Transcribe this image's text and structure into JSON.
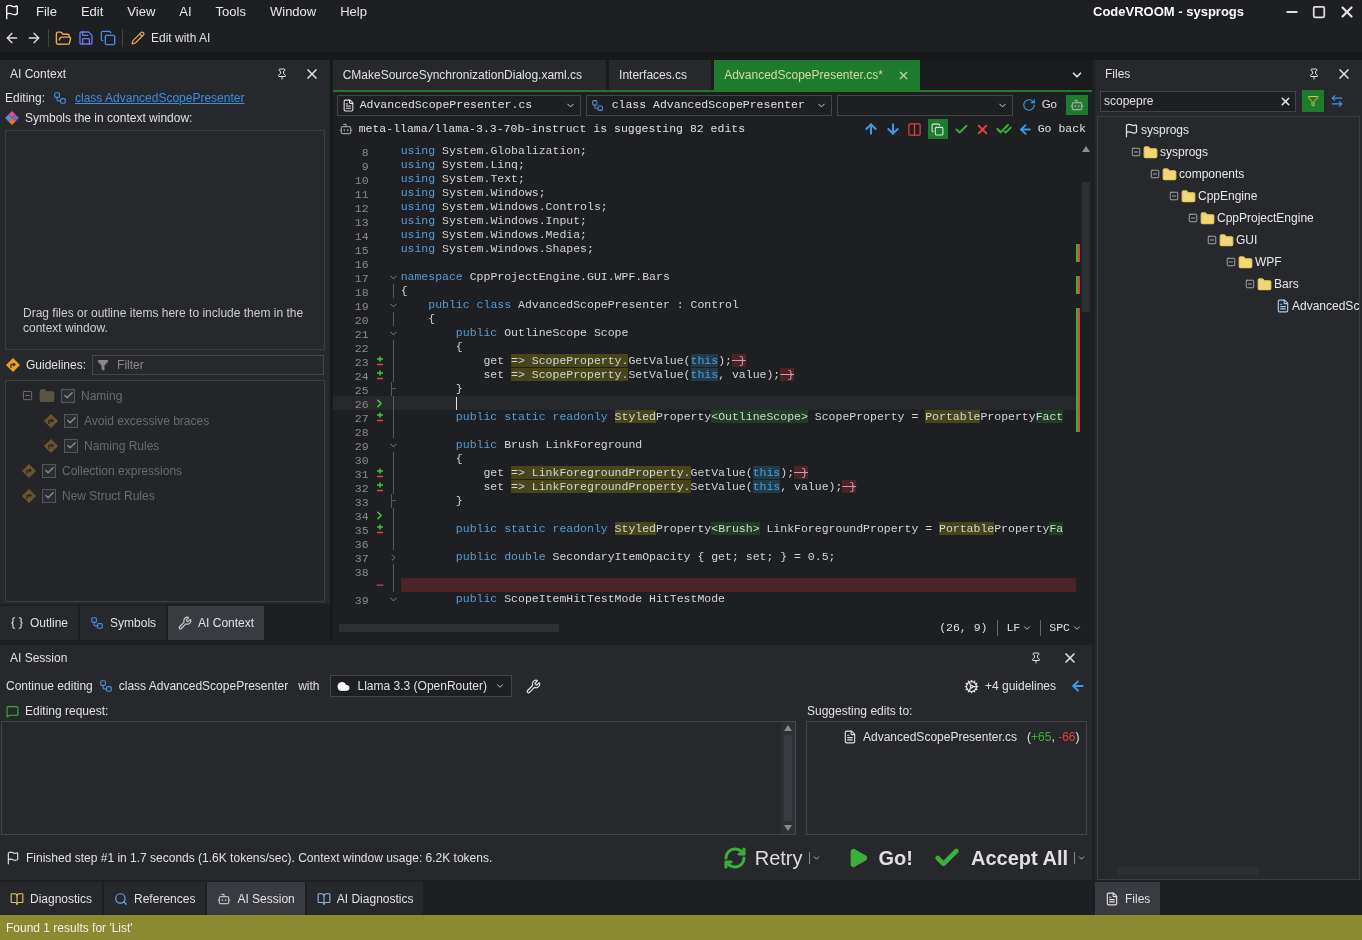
{
  "title_bar": {
    "title": "CodeVROOM - sysprogs"
  },
  "menu": [
    "File",
    "Edit",
    "View",
    "AI",
    "Tools",
    "Window",
    "Help"
  ],
  "toolbar": {
    "edit_ai": "Edit with AI"
  },
  "ai_context": {
    "title": "AI Context",
    "editing_label": "Editing:",
    "editing_link": "class AdvancedScopePresenter",
    "symbols_label": "Symbols the in context window:",
    "drop_hint": "Drag files or outline items here to include them in the context window.",
    "guidelines_label": "Guidelines:",
    "filter_placeholder": "Filter",
    "guidelines_disabled": true,
    "guidelines": [
      {
        "kind": "folder",
        "label": "Naming",
        "checked": true,
        "expanded": true,
        "children": [
          {
            "kind": "rule",
            "label": "Avoid excessive braces",
            "checked": true
          },
          {
            "kind": "rule",
            "label": "Naming Rules",
            "checked": true
          }
        ]
      },
      {
        "kind": "rule",
        "label": "Collection expressions",
        "checked": true
      },
      {
        "kind": "rule",
        "label": "New Struct Rules",
        "checked": true
      }
    ],
    "tabs": [
      {
        "kind": "outline",
        "label": "Outline",
        "selected": false
      },
      {
        "kind": "symbols",
        "label": "Symbols",
        "selected": false
      },
      {
        "kind": "context",
        "label": "AI Context",
        "selected": true
      }
    ]
  },
  "editor": {
    "tabs": [
      {
        "label": "CMakeSourceSynchronizationDialog.xaml.cs",
        "selected": false
      },
      {
        "label": "Interfaces.cs",
        "selected": false
      },
      {
        "label": "AdvancedScopePresenter.cs*",
        "selected": true
      }
    ],
    "file_combo": "AdvancedScopePresenter.cs",
    "class_combo": "class AdvancedScopePresenter",
    "go": "Go",
    "suggestion": "meta-llama/llama-3.3-70b-instruct is suggesting 82 edits",
    "go_back": "Go back",
    "lines": [
      {
        "kind": "code",
        "num": "8",
        "current": false,
        "segments": [
          {
            "kind": "keyword",
            "text": "using"
          },
          {
            "kind": "plain",
            "text": " System.Globalization;"
          }
        ]
      },
      {
        "kind": "code",
        "num": "9",
        "current": false,
        "segments": [
          {
            "kind": "keyword",
            "text": "using"
          },
          {
            "kind": "plain",
            "text": " System.Linq;"
          }
        ]
      },
      {
        "kind": "code",
        "num": "10",
        "current": false,
        "segments": [
          {
            "kind": "keyword",
            "text": "using"
          },
          {
            "kind": "plain",
            "text": " System.Text;"
          }
        ]
      },
      {
        "kind": "code",
        "num": "11",
        "current": false,
        "segments": [
          {
            "kind": "keyword",
            "text": "using"
          },
          {
            "kind": "plain",
            "text": " System.Windows;"
          }
        ]
      },
      {
        "kind": "code",
        "num": "12",
        "current": false,
        "segments": [
          {
            "kind": "keyword",
            "text": "using"
          },
          {
            "kind": "plain",
            "text": " System.Windows.Controls;"
          }
        ]
      },
      {
        "kind": "code",
        "num": "13",
        "current": false,
        "segments": [
          {
            "kind": "keyword",
            "text": "using"
          },
          {
            "kind": "plain",
            "text": " System.Windows.Input;"
          }
        ]
      },
      {
        "kind": "code",
        "num": "14",
        "current": false,
        "segments": [
          {
            "kind": "keyword",
            "text": "using"
          },
          {
            "kind": "plain",
            "text": " System.Windows.Media;"
          }
        ]
      },
      {
        "kind": "code",
        "num": "15",
        "current": false,
        "segments": [
          {
            "kind": "keyword",
            "text": "using"
          },
          {
            "kind": "plain",
            "text": " System.Windows.Shapes;"
          }
        ]
      },
      {
        "kind": "code",
        "num": "16",
        "current": false
      },
      {
        "kind": "code",
        "num": "17",
        "current": false,
        "fold": {
          "kind": "open"
        },
        "segments": [
          {
            "kind": "keyword",
            "text": "namespace"
          },
          {
            "kind": "plain",
            "text": " CppProjectEngine.GUI.WPF.Bars"
          }
        ]
      },
      {
        "kind": "code",
        "num": "18",
        "current": false,
        "fold": {
          "kind": "line"
        },
        "segments": [
          {
            "kind": "plain",
            "text": "{"
          }
        ]
      },
      {
        "kind": "code",
        "num": "19",
        "current": false,
        "fold": {
          "kind": "open"
        },
        "segments": [
          {
            "kind": "keyword",
            "text": "    public"
          },
          {
            "kind": "keyword",
            "text": " class"
          },
          {
            "kind": "plain",
            "text": " AdvancedScopePresenter : Control"
          }
        ]
      },
      {
        "kind": "code",
        "num": "20",
        "current": false,
        "fold": {
          "kind": "line"
        },
        "segments": [
          {
            "kind": "plain",
            "text": "    {"
          }
        ]
      },
      {
        "kind": "code",
        "num": "21",
        "current": false,
        "fold": {
          "kind": "open"
        },
        "segments": [
          {
            "kind": "keyword",
            "text": "        public"
          },
          {
            "kind": "plain",
            "text": " OutlineScope Scope"
          }
        ]
      },
      {
        "kind": "code",
        "num": "22",
        "current": false,
        "fold": {
          "kind": "line"
        },
        "segments": [
          {
            "kind": "plain",
            "text": "        {"
          }
        ]
      },
      {
        "kind": "code",
        "num": "23",
        "current": false,
        "fold": {
          "kind": "line"
        },
        "marker": {
          "kind": "change"
        },
        "segments": [
          {
            "kind": "plain",
            "text": "            get "
          },
          {
            "kind": "changed",
            "text": "=> ScopeProperty."
          },
          {
            "kind": "plain",
            "text": "GetValue("
          },
          {
            "kind": "keyword_changed",
            "text": "this"
          },
          {
            "kind": "plain",
            "text": ");"
          },
          {
            "kind": "deleted",
            "text": " }"
          }
        ]
      },
      {
        "kind": "code",
        "num": "24",
        "current": false,
        "fold": {
          "kind": "line"
        },
        "marker": {
          "kind": "change"
        },
        "segments": [
          {
            "kind": "plain",
            "text": "            set "
          },
          {
            "kind": "changed",
            "text": "=> ScopeProperty."
          },
          {
            "kind": "plain",
            "text": "SetValue("
          },
          {
            "kind": "keyword_changed",
            "text": "this"
          },
          {
            "kind": "plain",
            "text": ", value);"
          },
          {
            "kind": "deleted",
            "text": " }"
          }
        ]
      },
      {
        "kind": "code",
        "num": "25",
        "current": false,
        "fold": {
          "kind": "end"
        },
        "segments": [
          {
            "kind": "plain",
            "text": "        }"
          }
        ]
      },
      {
        "kind": "code",
        "num": "26",
        "current": true,
        "fold": {
          "kind": "line"
        },
        "marker": {
          "kind": "arrow"
        }
      },
      {
        "kind": "code",
        "num": "27",
        "current": false,
        "fold": {
          "kind": "line"
        },
        "marker": {
          "kind": "change"
        },
        "segments": [
          {
            "kind": "keyword",
            "text": "        public"
          },
          {
            "kind": "keyword",
            "text": " static"
          },
          {
            "kind": "keyword",
            "text": " readonly "
          },
          {
            "kind": "changed",
            "text": "Styled"
          },
          {
            "kind": "plain",
            "text": "Property"
          },
          {
            "kind": "inserted",
            "text": "<OutlineScope>"
          },
          {
            "kind": "plain",
            "text": " ScopeProperty = "
          },
          {
            "kind": "changed",
            "text": "Portable"
          },
          {
            "kind": "plain",
            "text": "Property"
          },
          {
            "kind": "inserted",
            "text": "Fact"
          }
        ]
      },
      {
        "kind": "code",
        "num": "28",
        "current": false,
        "fold": {
          "kind": "line"
        }
      },
      {
        "kind": "code",
        "num": "29",
        "current": false,
        "fold": {
          "kind": "open"
        },
        "segments": [
          {
            "kind": "keyword",
            "text": "        public"
          },
          {
            "kind": "plain",
            "text": " Brush LinkForeground"
          }
        ]
      },
      {
        "kind": "code",
        "num": "30",
        "current": false,
        "fold": {
          "kind": "line"
        },
        "segments": [
          {
            "kind": "plain",
            "text": "        {"
          }
        ]
      },
      {
        "kind": "code",
        "num": "31",
        "current": false,
        "fold": {
          "kind": "line"
        },
        "marker": {
          "kind": "change"
        },
        "segments": [
          {
            "kind": "plain",
            "text": "            get "
          },
          {
            "kind": "changed",
            "text": "=> LinkForegroundProperty."
          },
          {
            "kind": "plain",
            "text": "GetValue("
          },
          {
            "kind": "keyword_changed",
            "text": "this"
          },
          {
            "kind": "plain",
            "text": ");"
          },
          {
            "kind": "deleted",
            "text": " }"
          }
        ]
      },
      {
        "kind": "code",
        "num": "32",
        "current": false,
        "fold": {
          "kind": "line"
        },
        "marker": {
          "kind": "change"
        },
        "segments": [
          {
            "kind": "plain",
            "text": "            set "
          },
          {
            "kind": "changed",
            "text": "=> LinkForegroundProperty."
          },
          {
            "kind": "plain",
            "text": "SetValue("
          },
          {
            "kind": "keyword_changed",
            "text": "this"
          },
          {
            "kind": "plain",
            "text": ", value);"
          },
          {
            "kind": "deleted",
            "text": " }"
          }
        ]
      },
      {
        "kind": "code",
        "num": "33",
        "current": false,
        "fold": {
          "kind": "end"
        },
        "segments": [
          {
            "kind": "plain",
            "text": "        }"
          }
        ]
      },
      {
        "kind": "code",
        "num": "34",
        "current": false,
        "fold": {
          "kind": "line"
        },
        "marker": {
          "kind": "arrow"
        }
      },
      {
        "kind": "code",
        "num": "35",
        "current": false,
        "fold": {
          "kind": "line"
        },
        "marker": {
          "kind": "change"
        },
        "segments": [
          {
            "kind": "keyword",
            "text": "        public"
          },
          {
            "kind": "keyword",
            "text": " static"
          },
          {
            "kind": "keyword",
            "text": " readonly "
          },
          {
            "kind": "changed",
            "text": "Styled"
          },
          {
            "kind": "plain",
            "text": "Property"
          },
          {
            "kind": "inserted",
            "text": "<Brush>"
          },
          {
            "kind": "plain",
            "text": " LinkForegroundProperty = "
          },
          {
            "kind": "changed",
            "text": "Portable"
          },
          {
            "kind": "plain",
            "text": "Property"
          },
          {
            "kind": "inserted",
            "text": "Fa"
          }
        ]
      },
      {
        "kind": "code",
        "num": "36",
        "current": false,
        "fold": {
          "kind": "line"
        }
      },
      {
        "kind": "code",
        "num": "37",
        "current": false,
        "fold": {
          "kind": "closed"
        },
        "segments": [
          {
            "kind": "keyword",
            "text": "        public"
          },
          {
            "kind": "keyword",
            "text": " double"
          },
          {
            "kind": "plain",
            "text": " SecondaryItemOpacity { get; set; } = 0.5;"
          }
        ]
      },
      {
        "kind": "code",
        "num": "38",
        "current": false,
        "fold": {
          "kind": "line"
        }
      },
      {
        "kind": "removed",
        "current": false,
        "fold": {
          "kind": "line"
        },
        "marker": {
          "kind": "minus"
        }
      },
      {
        "kind": "code",
        "num": "39",
        "current": false,
        "fold": {
          "kind": "open"
        },
        "segments": [
          {
            "kind": "keyword",
            "text": "        public"
          },
          {
            "kind": "plain",
            "text": " ScopeItemHitTestMode HitTestMode"
          }
        ]
      }
    ],
    "position": "(26, 9)",
    "line_ending": "LF",
    "indent": "SPC"
  },
  "files": {
    "title": "Files",
    "search": "scopepre",
    "tree": [
      {
        "kind": "root",
        "label": "sysprogs",
        "children": [
          {
            "kind": "folder",
            "label": "sysprogs",
            "expanded": true,
            "children": [
              {
                "kind": "folder",
                "label": "components",
                "expanded": true,
                "children": [
                  {
                    "kind": "folder",
                    "label": "CppEngine",
                    "expanded": true,
                    "children": [
                      {
                        "kind": "folder",
                        "label": "CppProjectEngine",
                        "expanded": true,
                        "children": [
                          {
                            "kind": "folder",
                            "label": "GUI",
                            "expanded": true,
                            "children": [
                              {
                                "kind": "folder",
                                "label": "WPF",
                                "expanded": true,
                                "children": [
                                  {
                                    "kind": "folder",
                                    "label": "Bars",
                                    "expanded": true,
                                    "children": [
                                      {
                                        "kind": "file",
                                        "label": "AdvancedSc"
                                      }
                                    ]
                                  }
                                ]
                              }
                            ]
                          }
                        ]
                      }
                    ]
                  }
                ]
              }
            ]
          }
        ]
      }
    ],
    "tab": {
      "label": "Files",
      "selected": true
    }
  },
  "ai_session": {
    "title": "AI Session",
    "continue": "Continue editing",
    "target": "class AdvancedScopePresenter",
    "with": "with",
    "model": "Llama 3.3 (OpenRouter)",
    "guidelines": "+4 guidelines",
    "request_label": "Editing request:",
    "suggest_label": "Suggesting edits to:",
    "file": "AdvancedScopePresenter.cs",
    "summary": [
      {
        "kind": "plain",
        "text": "("
      },
      {
        "kind": "added",
        "text": "+65"
      },
      {
        "kind": "plain",
        "text": ", "
      },
      {
        "kind": "removed",
        "text": "-66"
      },
      {
        "kind": "plain",
        "text": ")"
      }
    ],
    "status": "Finished step #1 in 1.7 seconds (1.6K tokens/sec). Context window usage: 6.2K tokens.",
    "retry": "Retry",
    "go": "Go!",
    "accept": "Accept All"
  },
  "bottom_tabs": [
    {
      "kind": "diagnostics",
      "label": "Diagnostics",
      "selected": false
    },
    {
      "kind": "references",
      "label": "References",
      "selected": false
    },
    {
      "kind": "session",
      "label": "AI Session",
      "selected": true
    },
    {
      "kind": "ai_diagnostics",
      "label": "AI Diagnostics",
      "selected": false
    }
  ],
  "status_bar": "Found 1 results for 'List'"
}
